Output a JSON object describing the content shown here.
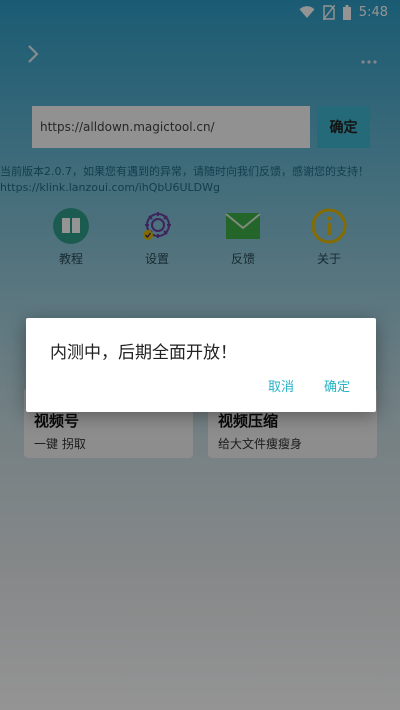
{
  "status_bar": {
    "time": "5:48",
    "icons": [
      "wifi-icon",
      "no-sim-icon",
      "battery-icon"
    ]
  },
  "topbar": {
    "back_icon": "chevron-right-icon",
    "more_icon": "more-dots-icon"
  },
  "url_bar": {
    "value": "https://alldown.magictool.cn/",
    "confirm_label": "确定"
  },
  "notice": {
    "text": "当前版本2.0.7，如果您有遇到的异常，请随时向我们反馈，感谢您的支持！",
    "link": "https://klink.lanzoui.com/ihQbU6ULDWg"
  },
  "features": [
    {
      "label": "教程",
      "icon": "book-icon"
    },
    {
      "label": "设置",
      "icon": "gear-icon"
    },
    {
      "label": "反馈",
      "icon": "mail-icon"
    },
    {
      "label": "关于",
      "icon": "info-icon"
    }
  ],
  "cards": [
    {
      "title": "视频号",
      "subtitle": "一键 拐取"
    },
    {
      "title": "视频压缩",
      "subtitle": "给大文件痩瘦身"
    }
  ],
  "dialog": {
    "message": "内测中，后期全面开放！",
    "cancel_label": "取消",
    "ok_label": "确定"
  },
  "colors": {
    "accent": "#26b3c7",
    "confirm_button": "#3eb7cf",
    "book_icon": "#2f9e8a",
    "mail_icon": "#3fae49",
    "info_icon": "#e6b800",
    "gear_icon": "#6a3ea1"
  }
}
